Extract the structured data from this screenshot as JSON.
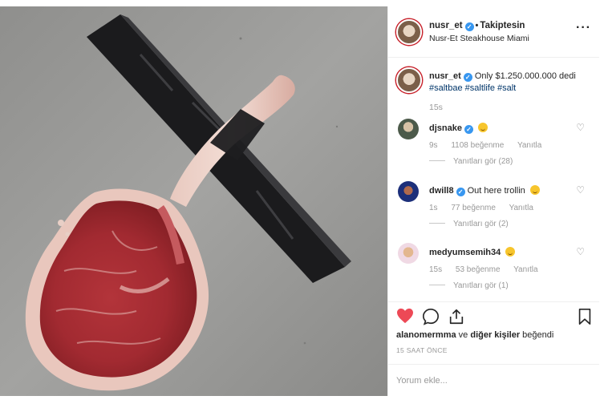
{
  "post": {
    "username": "nusr_et",
    "follow_status": "Takiptesin",
    "location": "Nusr-Et Steakhouse Miami",
    "caption_text": "Only $1.250.000.000 dedi",
    "hashtags": "#saltbae #saltlife #salt",
    "caption_time": "15s"
  },
  "comments": [
    {
      "username": "djsnake",
      "verified": true,
      "text": "",
      "time": "9s",
      "likes": "1108 beğenme",
      "reply": "Yanıtla",
      "view_replies": "Yanıtları gör (28)"
    },
    {
      "username": "dwill8",
      "verified": true,
      "text": "Out here trollin",
      "time": "1s",
      "likes": "77 beğenme",
      "reply": "Yanıtla",
      "view_replies": "Yanıtları gör (2)"
    },
    {
      "username": "medyumsemih34",
      "verified": false,
      "text": "",
      "time": "15s",
      "likes": "53 beğenme",
      "reply": "Yanıtla",
      "view_replies": "Yanıtları gör (1)"
    }
  ],
  "liked_by": {
    "user": "alanomermma",
    "connector": "ve",
    "others": "diğer kişiler",
    "suffix": "beğendi"
  },
  "time_ago": "15 SAAT ÖNCE",
  "add_comment": {
    "placeholder": "Yorum ekle..."
  },
  "colors": {
    "verified": "#3897f0",
    "liked_heart": "#ed4956",
    "hashtag": "#003569"
  },
  "icons": [
    "more-options-icon",
    "verified-badge-icon",
    "heart-icon",
    "comment-icon",
    "share-icon",
    "bookmark-icon",
    "emoji-icon"
  ]
}
